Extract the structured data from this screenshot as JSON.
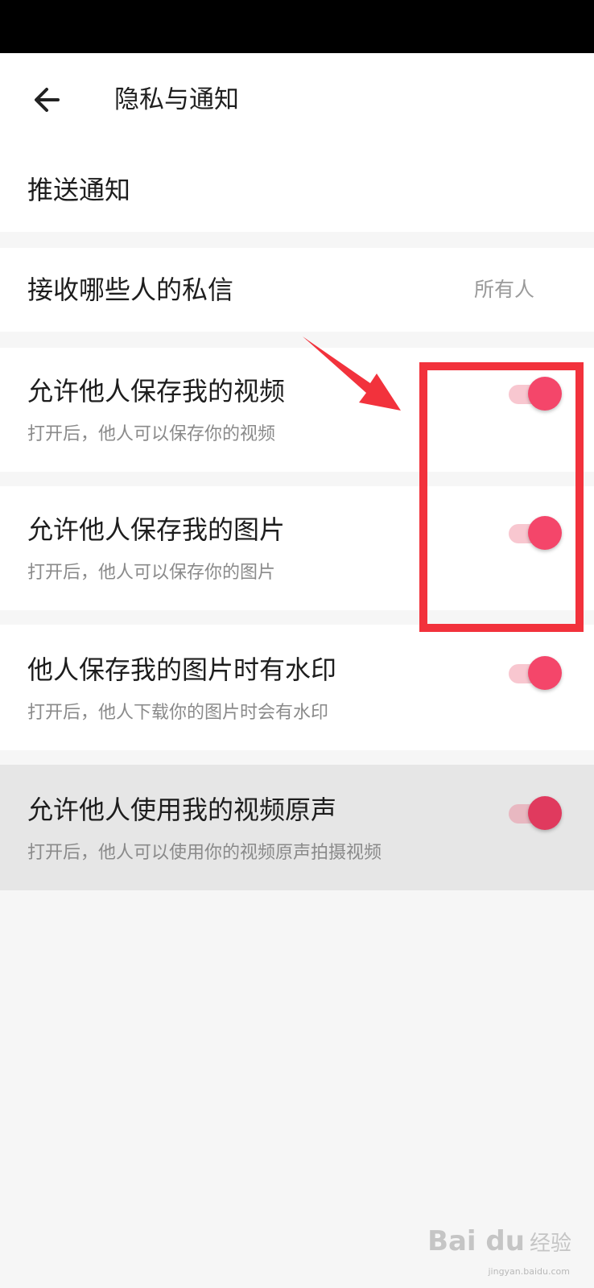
{
  "header": {
    "title": "隐私与通知",
    "back_icon": "arrow-left-icon"
  },
  "rows": {
    "push": {
      "title": "推送通知"
    },
    "messages": {
      "title": "接收哪些人的私信",
      "value": "所有人"
    },
    "save_video": {
      "title": "允许他人保存我的视频",
      "subtitle": "打开后，他人可以保存你的视频",
      "enabled": true
    },
    "save_photo": {
      "title": "允许他人保存我的图片",
      "subtitle": "打开后，他人可以保存你的图片",
      "enabled": true
    },
    "watermark": {
      "title": "他人保存我的图片时有水印",
      "subtitle": "打开后，他人下载你的图片时会有水印",
      "enabled": true
    },
    "original_sound": {
      "title": "允许他人使用我的视频原声",
      "subtitle": "打开后，他人可以使用你的视频原声拍摄视频",
      "enabled": true
    }
  },
  "colors": {
    "toggle_on": "#f4466a",
    "toggle_track": "#f8c7d0",
    "highlight": "#f2323c"
  },
  "watermark": {
    "logo": "Bai du",
    "brand": "经验",
    "url": "jingyan.baidu.com"
  }
}
